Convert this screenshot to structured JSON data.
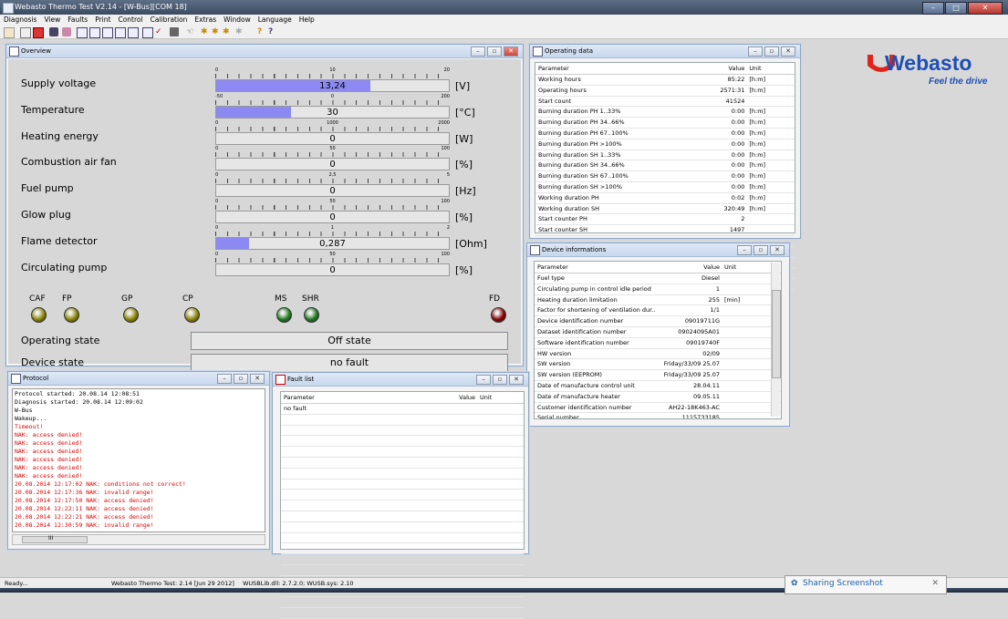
{
  "app": {
    "title": "Webasto Thermo Test V2.14 - [W-Bus][COM 18]"
  },
  "menu": [
    "Diagnosis",
    "View",
    "Faults",
    "Print",
    "Control",
    "Calibration",
    "Extras",
    "Window",
    "Language",
    "Help"
  ],
  "colors": {
    "bar_fill": "#8c89f2",
    "led_olive": "#8a8400",
    "led_green": "#1e7a1e",
    "led_red": "#8a0000",
    "brand": "#1e4fb4"
  },
  "overview": {
    "title": "Overview",
    "gauges": [
      {
        "label": "Supply voltage",
        "value": "13,24",
        "unit": "[V]",
        "scale": [
          "0",
          "10",
          "20"
        ],
        "fraction": 0.662
      },
      {
        "label": "Temperature",
        "value": "30",
        "unit": "[°C]",
        "scale": [
          "-50",
          "0",
          "200"
        ],
        "fraction": 0.32
      },
      {
        "label": "Heating energy",
        "value": "0",
        "unit": "[W]",
        "scale": [
          "0",
          "1000",
          "2000"
        ],
        "fraction": 0
      },
      {
        "label": "Combustion air fan",
        "value": "0",
        "unit": "[%]",
        "scale": [
          "0",
          "50",
          "100"
        ],
        "fraction": 0
      },
      {
        "label": "Fuel pump",
        "value": "0",
        "unit": "[Hz]",
        "scale": [
          "0",
          "2,5",
          "5"
        ],
        "fraction": 0
      },
      {
        "label": "Glow plug",
        "value": "0",
        "unit": "[%]",
        "scale": [
          "0",
          "50",
          "100"
        ],
        "fraction": 0
      },
      {
        "label": "Flame detector",
        "value": "0,287",
        "unit": "[Ohm]",
        "scale": [
          "0",
          "1",
          "2"
        ],
        "fraction": 0.143
      },
      {
        "label": "Circulating pump",
        "value": "0",
        "unit": "[%]",
        "scale": [
          "0",
          "50",
          "100"
        ],
        "fraction": 0
      }
    ],
    "leds": [
      {
        "label": "CAF",
        "color": "olive"
      },
      {
        "label": "FP",
        "color": "olive"
      },
      {
        "label": "GP",
        "color": "olive"
      },
      {
        "label": "CP",
        "color": "olive"
      },
      {
        "label": "MS",
        "color": "green"
      },
      {
        "label": "SHR",
        "color": "green"
      },
      {
        "label": "FD",
        "color": "red"
      }
    ],
    "operating_state_label": "Operating state",
    "operating_state": "Off state",
    "device_state_label": "Device state",
    "device_state": "no fault"
  },
  "operating_data": {
    "title": "Operating data",
    "headers": [
      "Parameter",
      "Value",
      "Unit"
    ],
    "rows": [
      [
        "Working hours",
        "85:22",
        "[h:m]"
      ],
      [
        "Operating hours",
        "2571:31",
        "[h:m]"
      ],
      [
        "Start count",
        "41524",
        ""
      ],
      [
        "Burning duration PH 1..33%",
        "0:00",
        "[h:m]"
      ],
      [
        "Burning duration PH 34..66%",
        "0:00",
        "[h:m]"
      ],
      [
        "Burning duration PH 67..100%",
        "0:00",
        "[h:m]"
      ],
      [
        "Burning duration PH >100%",
        "0:00",
        "[h:m]"
      ],
      [
        "Burning duration SH 1..33%",
        "0:00",
        "[h:m]"
      ],
      [
        "Burning duration SH 34..66%",
        "0:00",
        "[h:m]"
      ],
      [
        "Burning duration SH 67..100%",
        "0:00",
        "[h:m]"
      ],
      [
        "Burning duration SH >100%",
        "0:00",
        "[h:m]"
      ],
      [
        "Working duration PH",
        "0:02",
        "[h:m]"
      ],
      [
        "Working duration SH",
        "320:49",
        "[h:m]"
      ],
      [
        "Start counter PH",
        "2",
        ""
      ],
      [
        "Start counter SH",
        "1497",
        ""
      ]
    ]
  },
  "device_info": {
    "title": "Device informations",
    "headers": [
      "Parameter",
      "Value",
      "Unit"
    ],
    "rows": [
      [
        "Fuel type",
        "Diesel",
        ""
      ],
      [
        "Circulating pump in control idle period",
        "1",
        ""
      ],
      [
        "Heating duration limitation",
        "255",
        "[min]"
      ],
      [
        "Factor for shortening of ventilation dur...",
        "1/1",
        ""
      ],
      [
        "Device identification number",
        "09019711G",
        ""
      ],
      [
        "Dataset identification number",
        "09024095A01",
        ""
      ],
      [
        "Software identification number",
        "09019740F",
        ""
      ],
      [
        "HW version",
        "02/09",
        ""
      ],
      [
        "SW version",
        "Friday/33/09 25.07",
        ""
      ],
      [
        "SW version (EEPROM)",
        "Friday/33/09 25.07",
        ""
      ],
      [
        "Date of manufacture control unit",
        "28.04.11",
        ""
      ],
      [
        "Date of manufacture heater",
        "09.05.11",
        ""
      ],
      [
        "Customer identification number",
        "AH22-18K463-AC",
        ""
      ],
      [
        "Serial number",
        "1115733185",
        ""
      ]
    ]
  },
  "protocol": {
    "title": "Protocol",
    "lines": [
      {
        "t": "Protocol started: 20.08.14 12:08:51",
        "red": false
      },
      {
        "t": "Diagnosis started: 20.08.14 12:09:02",
        "red": false
      },
      {
        "t": "W-Bus",
        "red": false
      },
      {
        "t": "Wakeup...",
        "red": false
      },
      {
        "t": "Timeout!",
        "red": true
      },
      {
        "t": "NAK: access denied!",
        "red": true
      },
      {
        "t": "NAK: access denied!",
        "red": true
      },
      {
        "t": "NAK: access denied!",
        "red": true
      },
      {
        "t": "NAK: access denied!",
        "red": true
      },
      {
        "t": "NAK: access denied!",
        "red": true
      },
      {
        "t": "NAK: access denied!",
        "red": true
      },
      {
        "t": "20.08.2014 12:17:02 NAK: conditions not correct!",
        "red": true
      },
      {
        "t": "20.08.2014 12:17:36 NAK: invalid range!",
        "red": true
      },
      {
        "t": "20.08.2014 12:17:50 NAK: access denied!",
        "red": true
      },
      {
        "t": "20.08.2014 12:22:11 NAK: access denied!",
        "red": true
      },
      {
        "t": "20.08.2014 12:22:21 NAK: access denied!",
        "red": true
      },
      {
        "t": "20.08.2014 12:30:59 NAK: invalid range!",
        "red": true
      }
    ],
    "scroll_mark": "III"
  },
  "fault_list": {
    "title": "Fault list",
    "headers": [
      "Parameter",
      "Value",
      "Unit"
    ],
    "rows": [
      [
        "no fault",
        "",
        ""
      ]
    ]
  },
  "logo": {
    "name": "Webasto",
    "tagline": "Feel the drive"
  },
  "status": {
    "left": "Ready...",
    "version": "Webasto Thermo Test: 2.14 [Jun 29 2012]",
    "lib": "WUSBLib.dll: 2.7.2.0; WUSB.sys: 2.10"
  },
  "notification": {
    "text": "Sharing Screenshot"
  }
}
